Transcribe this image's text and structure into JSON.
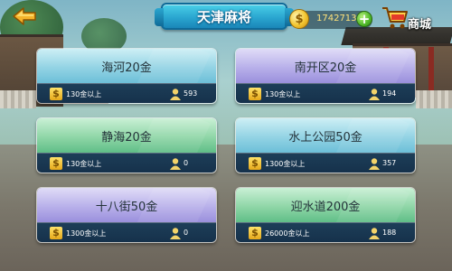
{
  "header": {
    "title": "天津麻将",
    "coins": "1742713",
    "shop_label": "商城",
    "coin_symbol": "$",
    "add_symbol": "+"
  },
  "rooms": [
    {
      "name": "海河20金",
      "min_coins": "130金以上",
      "players": "593",
      "theme": "blue"
    },
    {
      "name": "南开区20金",
      "min_coins": "130金以上",
      "players": "194",
      "theme": "purple"
    },
    {
      "name": "静海20金",
      "min_coins": "130金以上",
      "players": "0",
      "theme": "green"
    },
    {
      "name": "水上公园50金",
      "min_coins": "1300金以上",
      "players": "357",
      "theme": "blue"
    },
    {
      "name": "十八街50金",
      "min_coins": "1300金以上",
      "players": "0",
      "theme": "purple"
    },
    {
      "name": "迎水道200金",
      "min_coins": "26000金以上",
      "players": "188",
      "theme": "green"
    }
  ],
  "icons": {
    "back": "back-arrow-icon",
    "coin": "coin-icon",
    "add": "plus-icon",
    "shop": "shopping-cart-icon",
    "min_coins": "dollar-icon",
    "players": "player-icon"
  },
  "colors": {
    "title_banner": "#2aa6d0",
    "coin_text": "#ffe27a",
    "card_footer": "#1d3e58",
    "blue_card": "#93d3e4",
    "green_card": "#8fd6a7",
    "purple_card": "#b8b0ea"
  }
}
